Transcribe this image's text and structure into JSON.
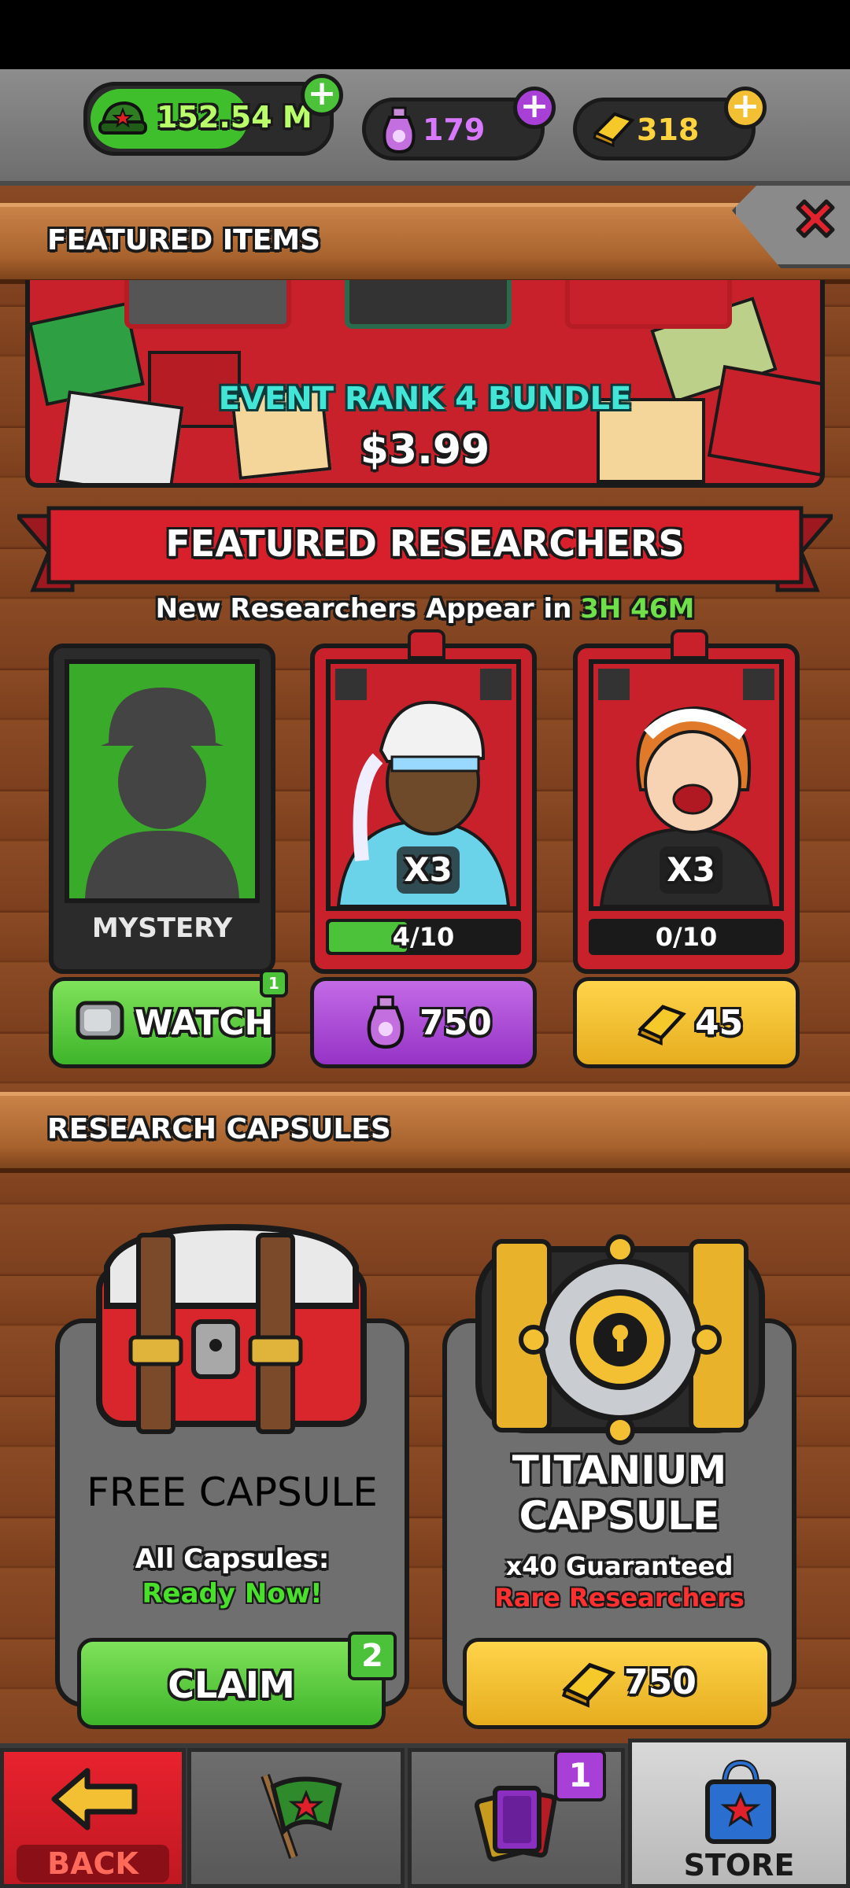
{
  "currency": {
    "cash": "152.54 M",
    "potions": "179",
    "gold": "318"
  },
  "featured_items": {
    "header": "FEATURED ITEMS",
    "offer_title": "EVENT RANK 4 BUNDLE",
    "offer_price": "$3.99"
  },
  "featured_researchers": {
    "banner": "FEATURED RESEARCHERS",
    "timer_prefix": "New Researchers Appear in",
    "timer_value": "3H 46M",
    "cards": [
      {
        "label": "MYSTERY",
        "button": "WATCH",
        "button_badge": "1"
      },
      {
        "multiplier": "X3",
        "progress": "4/10",
        "progress_fraction": 0.4,
        "button": "750"
      },
      {
        "multiplier": "X3",
        "progress": "0/10",
        "progress_fraction": 0.0,
        "button": "45"
      }
    ]
  },
  "research_capsules": {
    "header": "RESEARCH CAPSULES",
    "free": {
      "title": "FREE CAPSULE",
      "line1": "All Capsules:",
      "line2": "Ready Now!",
      "button": "CLAIM",
      "badge": "2"
    },
    "titanium": {
      "title_line1": "TITANIUM",
      "title_line2": "CAPSULE",
      "line1": "x40 Guaranteed",
      "line2": "Rare Researchers",
      "button": "750"
    }
  },
  "bottom_nav": {
    "back": "BACK",
    "cards_badge": "1",
    "store": "STORE"
  },
  "colors": {
    "green": "#4bc23a",
    "purple": "#a83fd6",
    "gold": "#f2c032",
    "red": "#d8202c"
  }
}
